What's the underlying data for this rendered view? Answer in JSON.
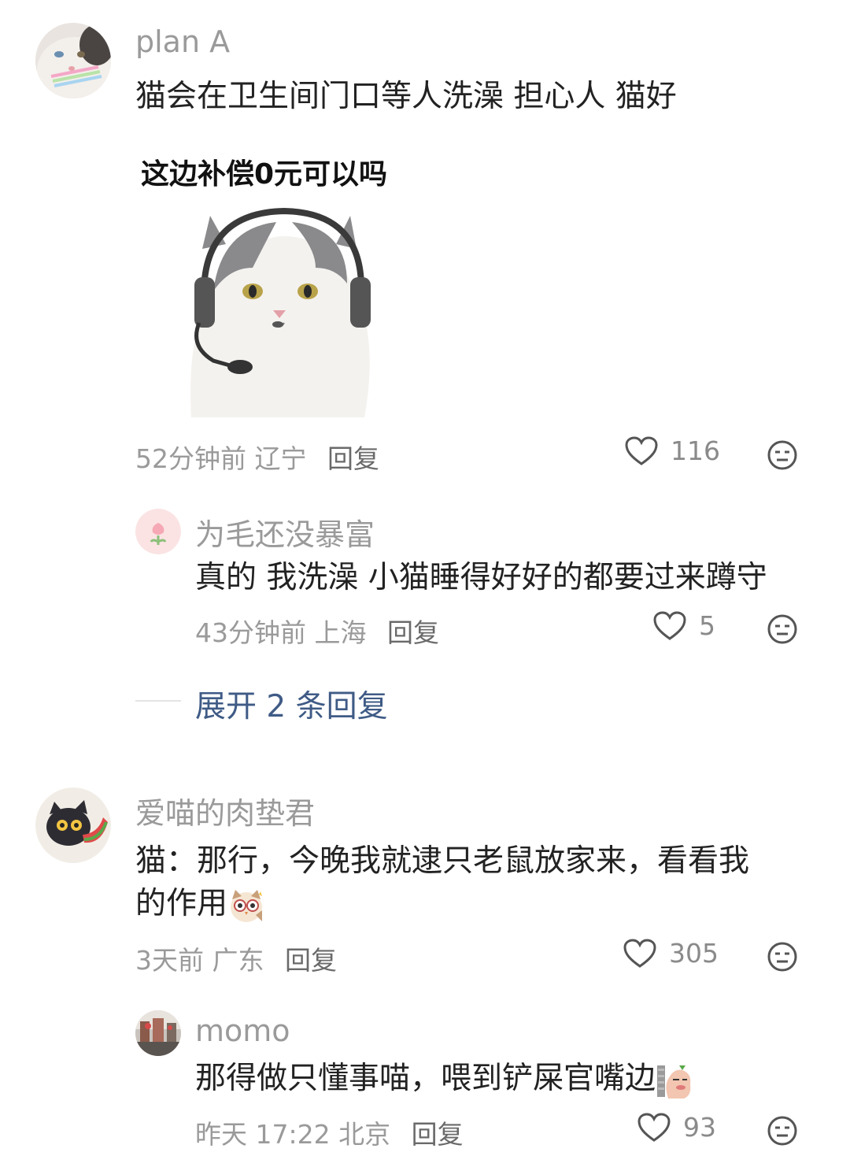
{
  "comments": [
    {
      "username": "plan A",
      "text": "猫会在卫生间门口等人洗澡 担心人 猫好",
      "sticker_caption": "这边补偿0元可以吗",
      "time": "52分钟前",
      "location": "辽宁",
      "reply_label": "回复",
      "likes": "116",
      "replies": [
        {
          "username": "为毛还没暴富",
          "text": "真的 我洗澡 小猫睡得好好的都要过来蹲守",
          "time": "43分钟前",
          "location": "上海",
          "reply_label": "回复",
          "likes": "5"
        }
      ],
      "expand_label": "展开 2 条回复"
    },
    {
      "username": "爱喵的肉垫君",
      "text_line1": "猫：那行，今晚我就逮只老鼠放家来，看看我",
      "text_line2": "的作用",
      "time": "3天前",
      "location": "广东",
      "reply_label": "回复",
      "likes": "305",
      "replies": [
        {
          "username": "momo",
          "text": "那得做只懂事喵，喂到铲屎官嘴边",
          "time": "昨天 17:22",
          "location": "北京",
          "reply_label": "回复",
          "likes": "93"
        }
      ]
    }
  ],
  "icons": {
    "like": "heart-outline-icon",
    "dislike": "meh-face-icon"
  },
  "colors": {
    "link": "#3f5b86",
    "meta": "#9a9a9a",
    "text": "#222222"
  }
}
